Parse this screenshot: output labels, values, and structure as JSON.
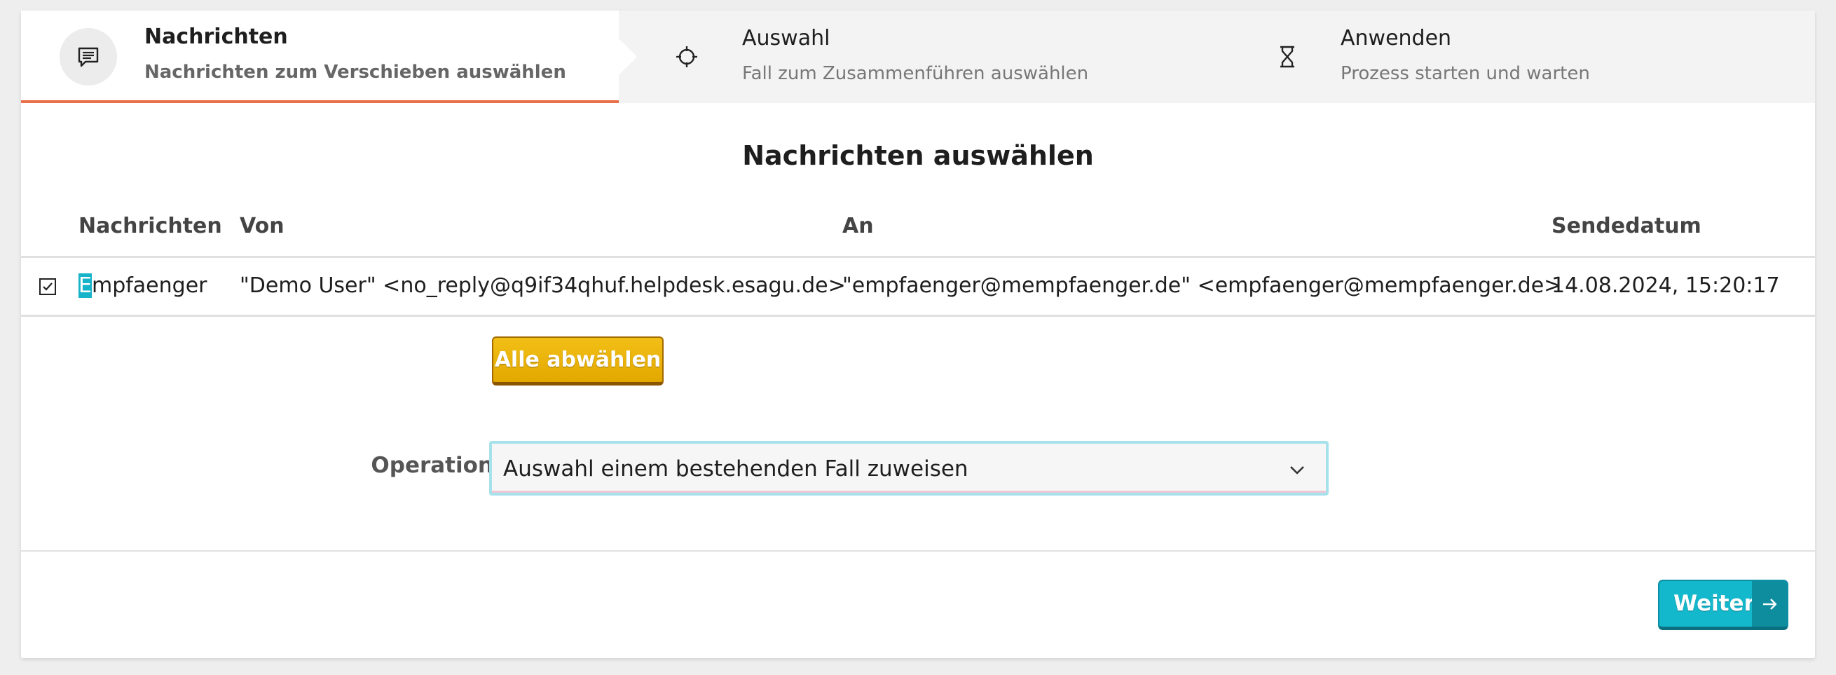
{
  "steps": [
    {
      "title": "Nachrichten",
      "subtitle": "Nachrichten zum Verschieben auswählen",
      "icon": "message-icon",
      "active": true
    },
    {
      "title": "Auswahl",
      "subtitle": "Fall zum Zusammenführen auswählen",
      "icon": "crosshair-icon",
      "active": false
    },
    {
      "title": "Anwenden",
      "subtitle": "Prozess starten und warten",
      "icon": "hourglass-icon",
      "active": false
    }
  ],
  "page": {
    "title": "Nachrichten auswählen"
  },
  "table": {
    "headers": {
      "name": "Nachrichten",
      "from": "Von",
      "to": "An",
      "date": "Sendedatum"
    },
    "rows": [
      {
        "checked": true,
        "name_first": "E",
        "name_rest": "mpfaenger",
        "from": "\"Demo User\" <no_reply@q9if34qhuf.helpdesk.esagu.de>",
        "to": "\"empfaenger@mempfaenger.de\" <empfaenger@mempfaenger.de>",
        "date": "14.08.2024, 15:20:17"
      }
    ]
  },
  "actions": {
    "deselect_all": "Alle abwählen",
    "next": "Weiter"
  },
  "operation": {
    "label": "Operation",
    "value": "Auswahl einem bestehenden Fall zuweisen"
  },
  "colors": {
    "accent_orange": "#e8704a",
    "button_yellow": "#e8b00a",
    "button_teal": "#14b8cc",
    "highlight": "#16b3c9"
  }
}
